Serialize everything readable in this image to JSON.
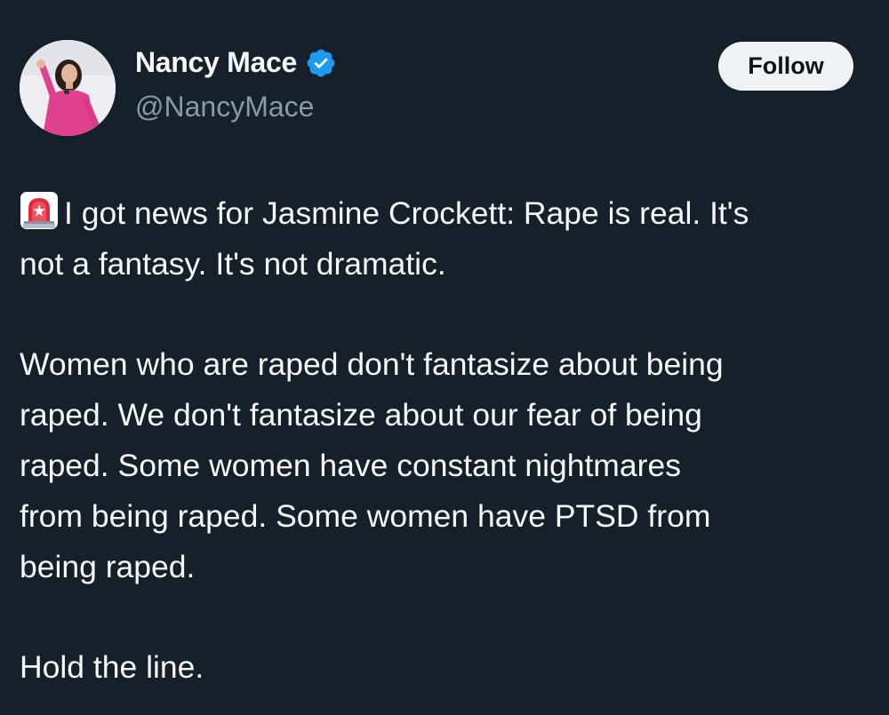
{
  "author": {
    "display_name": "Nancy Mace",
    "handle": "@NancyMace",
    "verified": true,
    "avatar_icon": "profile-photo"
  },
  "follow_button": {
    "label": "Follow"
  },
  "tweet": {
    "emoji": "rotating-light-icon",
    "paragraphs": [
      {
        "lines": [
          "I got news for Jasmine Crockett: Rape is real. It's",
          "not a fantasy. It's not dramatic."
        ]
      },
      {
        "lines": [
          "Women who are raped don't fantasize about being",
          "raped. We don't fantasize about our fear of being",
          "raped. Some women have constant nightmares",
          "from being raped. Some women have PTSD from",
          "being raped."
        ]
      },
      {
        "lines": [
          "Hold the line."
        ]
      }
    ]
  },
  "colors": {
    "background": "#15202b",
    "text": "#f7f9f9",
    "secondary_text": "#8b98a5",
    "verified_badge": "#1d9bf0",
    "follow_button_bg": "#eff3f4"
  }
}
